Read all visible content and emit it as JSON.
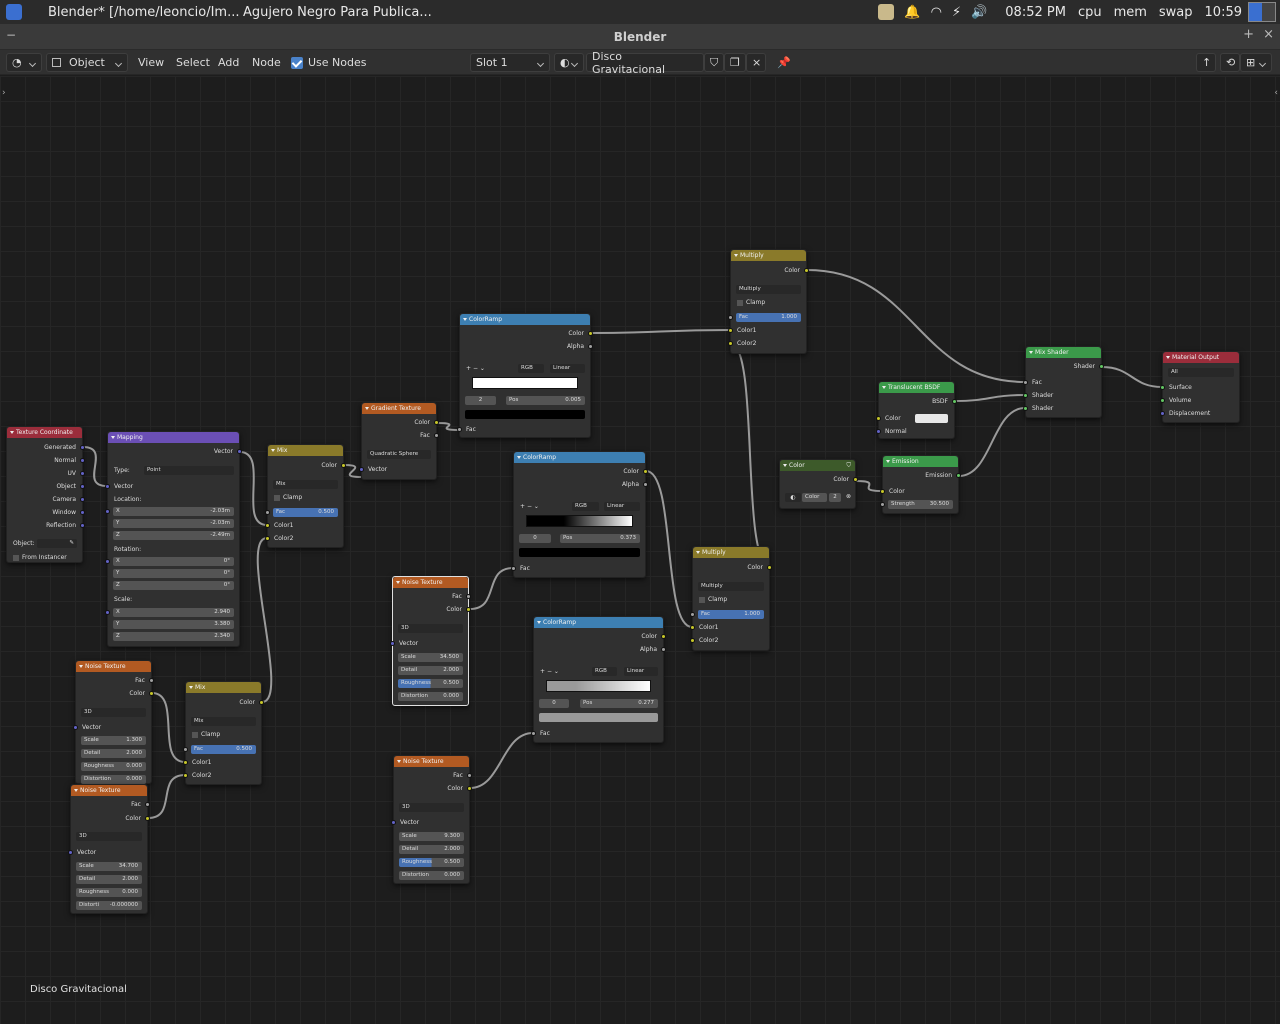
{
  "taskbar": {
    "app": "Blender* [/home/leoncio/Im...",
    "folder": "Agujero Negro Para Publica...",
    "time": "08:52 PM",
    "cpu": "cpu",
    "mem": "mem",
    "swap": "swap",
    "clock2": "10:59"
  },
  "window": {
    "title": "Blender"
  },
  "header": {
    "mode": "Object",
    "menus": [
      "View",
      "Select",
      "Add",
      "Node"
    ],
    "use_nodes": "Use Nodes",
    "slot": "Slot 1",
    "material": "Disco Gravitacional"
  },
  "footer": {
    "material_label": "Disco Gravitacional"
  },
  "nodes": {
    "texcoord": {
      "title": "Texture Coordinate",
      "outputs": [
        "Generated",
        "Normal",
        "UV",
        "Object",
        "Camera",
        "Window",
        "Reflection"
      ],
      "object_label": "Object:",
      "from_instancer": "From Instancer"
    },
    "mapping": {
      "title": "Mapping",
      "out": "Vector",
      "type_label": "Type:",
      "type": "Point",
      "in_vector": "Vector",
      "location": "Location:",
      "rotation": "Rotation:",
      "scale": "Scale:",
      "loc": [
        [
          "X",
          "-2.03m"
        ],
        [
          "Y",
          "-2.03m"
        ],
        [
          "Z",
          "-2.49m"
        ]
      ],
      "rot": [
        [
          "X",
          "0°"
        ],
        [
          "Y",
          "0°"
        ],
        [
          "Z",
          "0°"
        ]
      ],
      "scl": [
        [
          "X",
          "2.940"
        ],
        [
          "Y",
          "3.380"
        ],
        [
          "Z",
          "2.340"
        ]
      ]
    },
    "mix1": {
      "title": "Mix",
      "out": "Color",
      "blend": "Mix",
      "clamp": "Clamp",
      "fac": "Fac",
      "fac_v": "0.500",
      "c1": "Color1",
      "c2": "Color2"
    },
    "gradient": {
      "title": "Gradient Texture",
      "out1": "Color",
      "out2": "Fac",
      "type": "Quadratic Sphere",
      "in": "Vector"
    },
    "ramp1": {
      "title": "ColorRamp",
      "out1": "Color",
      "out2": "Alpha",
      "mode": "RGB",
      "interp": "Linear",
      "idx": "2",
      "pos": "Pos",
      "pos_v": "0.005",
      "in": "Fac"
    },
    "ramp2": {
      "title": "ColorRamp",
      "out1": "Color",
      "out2": "Alpha",
      "mode": "RGB",
      "interp": "Linear",
      "idx": "0",
      "pos": "Pos",
      "pos_v": "0.373",
      "in": "Fac"
    },
    "ramp3": {
      "title": "ColorRamp",
      "out1": "Color",
      "out2": "Alpha",
      "mode": "RGB",
      "interp": "Linear",
      "idx": "0",
      "pos": "Pos",
      "pos_v": "0.277",
      "in": "Fac"
    },
    "mult1": {
      "title": "Multiply",
      "out": "Color",
      "blend": "Multiply",
      "clamp": "Clamp",
      "fac": "Fac",
      "fac_v": "1.000",
      "c1": "Color1",
      "c2": "Color2"
    },
    "mult2": {
      "title": "Multiply",
      "out": "Color",
      "blend": "Multiply",
      "clamp": "Clamp",
      "fac": "Fac",
      "fac_v": "1.000",
      "c1": "Color1",
      "c2": "Color2"
    },
    "noise_sel": {
      "title": "Noise Texture",
      "o1": "Fac",
      "o2": "Color",
      "dim": "3D",
      "vec": "Vector",
      "f": [
        [
          "Scale",
          "34.500"
        ],
        [
          "Detail",
          "2.000"
        ],
        [
          "Roughness",
          "0.500"
        ],
        [
          "Distortion",
          "0.000"
        ]
      ]
    },
    "noise_bot": {
      "title": "Noise Texture",
      "o1": "Fac",
      "o2": "Color",
      "dim": "3D",
      "vec": "Vector",
      "f": [
        [
          "Scale",
          "9.300"
        ],
        [
          "Detail",
          "2.000"
        ],
        [
          "Roughness",
          "0.500"
        ],
        [
          "Distortion",
          "0.000"
        ]
      ]
    },
    "noise_left1": {
      "title": "Noise Texture",
      "o1": "Fac",
      "o2": "Color",
      "dim": "3D",
      "vec": "Vector",
      "f": [
        [
          "Scale",
          "1.300"
        ],
        [
          "Detail",
          "2.000"
        ],
        [
          "Roughness",
          "0.000"
        ],
        [
          "Distortion",
          "0.000"
        ]
      ]
    },
    "noise_left2": {
      "title": "Noise Texture",
      "o1": "Fac",
      "o2": "Color",
      "dim": "3D",
      "vec": "Vector",
      "f": [
        [
          "Scale",
          "34.700"
        ],
        [
          "Detail",
          "2.000"
        ],
        [
          "Roughness",
          "0.000"
        ],
        [
          "Distorti",
          "-0.000000"
        ]
      ]
    },
    "mix2": {
      "title": "Mix",
      "out": "Color",
      "blend": "Mix",
      "clamp": "Clamp",
      "fac": "Fac",
      "fac_v": "0.500",
      "c1": "Color1",
      "c2": "Color2"
    },
    "translucent": {
      "title": "Translucent BSDF",
      "out": "BSDF",
      "color": "Color",
      "normal": "Normal"
    },
    "emission": {
      "title": "Emission",
      "out": "Emission",
      "color": "Color",
      "strength": "Strength",
      "strength_v": "30.500"
    },
    "colornode": {
      "title": "Color",
      "out": "Color",
      "lbl": "Color",
      "num": "2"
    },
    "mixshader": {
      "title": "Mix Shader",
      "out": "Shader",
      "fac": "Fac",
      "s1": "Shader",
      "s2": "Shader"
    },
    "matout": {
      "title": "Material Output",
      "target": "All",
      "surface": "Surface",
      "volume": "Volume",
      "disp": "Displacement"
    }
  }
}
